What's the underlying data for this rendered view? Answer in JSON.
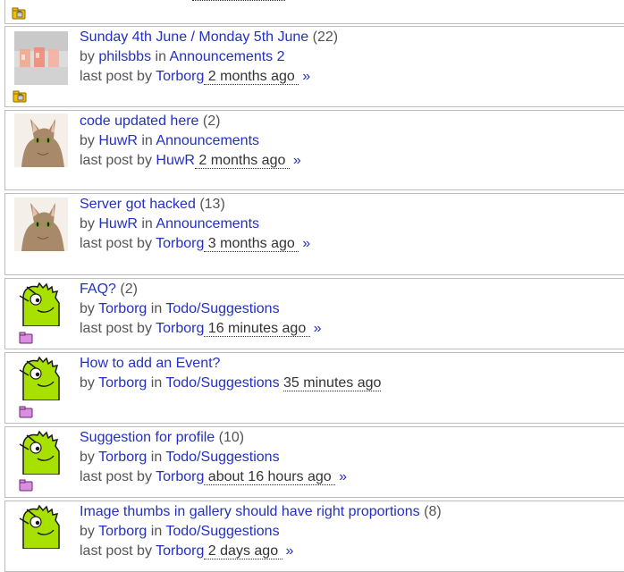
{
  "strings": {
    "by": "by",
    "in": "in",
    "last_post": "last post",
    "more": "»"
  },
  "topics": [
    {
      "title": "Sunday 4th June / Monday 5th June",
      "count": "(22)",
      "author": "philsbbs",
      "forum": "Announcements 2",
      "last_by": "Torborg",
      "ago": " 2 months ago ",
      "avatar": "photo-drinks",
      "badge": "folder-locked"
    },
    {
      "title": "code updated here",
      "count": "(2)",
      "author": "HuwR",
      "forum": "Announcements",
      "last_by": "HuwR",
      "ago": " 2 months ago ",
      "avatar": "cat",
      "badge": ""
    },
    {
      "title": "Server got hacked",
      "count": "(13)",
      "author": "HuwR",
      "forum": "Announcements",
      "last_by": "Torborg",
      "ago": " 3 months ago ",
      "avatar": "cat",
      "badge": ""
    },
    {
      "title": "FAQ?",
      "count": "(2)",
      "author": "Torborg",
      "forum": "Todo/Suggestions",
      "last_by": "Torborg",
      "ago": " 16 minutes ago ",
      "avatar": "green-monster",
      "badge": "folder-pink"
    },
    {
      "title": "How to add an Event?",
      "count": "",
      "author": "Torborg",
      "forum": "Todo/Suggestions",
      "last_by": "",
      "ago": " 35 minutes ago ",
      "avatar": "green-monster",
      "badge": "folder-pink"
    },
    {
      "title": "Suggestion for profile",
      "count": "(10)",
      "author": "Torborg",
      "forum": "Todo/Suggestions",
      "last_by": "Torborg",
      "ago": " about 16 hours ago ",
      "avatar": "green-monster",
      "badge": "folder-pink"
    },
    {
      "title": "Image thumbs in gallery should have right proportions",
      "count": "(8)",
      "author": "Torborg",
      "forum": "Todo/Suggestions",
      "last_by": "Torborg",
      "ago": " 2 days ago ",
      "avatar": "green-monster",
      "badge": ""
    }
  ]
}
